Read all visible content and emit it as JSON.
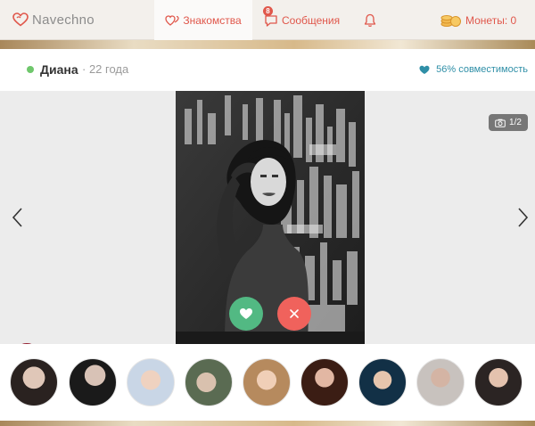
{
  "header": {
    "logo_text": "Navechno",
    "nav": {
      "dating_label": "Знакомства",
      "messages_label": "Сообщения",
      "messages_badge": "8",
      "coins_label": "Монеты: 0"
    }
  },
  "profile": {
    "name": "Диана",
    "age": "· 22 года",
    "compatibility": "56% совместимость",
    "photo_counter": "1/2",
    "online": true
  },
  "thumbnails": [
    {
      "name": "thumb-1",
      "icon": "avatar-photo"
    },
    {
      "name": "thumb-2",
      "icon": "avatar-photo"
    },
    {
      "name": "thumb-3",
      "icon": "avatar-photo"
    },
    {
      "name": "thumb-4",
      "icon": "avatar-photo"
    },
    {
      "name": "thumb-5",
      "icon": "avatar-photo"
    },
    {
      "name": "thumb-6",
      "icon": "avatar-photo"
    },
    {
      "name": "thumb-7",
      "icon": "avatar-photo"
    },
    {
      "name": "thumb-8",
      "icon": "avatar-photo"
    },
    {
      "name": "thumb-9",
      "icon": "avatar-photo"
    }
  ],
  "colors": {
    "brand": "#e0574b",
    "like": "#52b983",
    "skip": "#f0625c",
    "online": "#6fc76c",
    "compat": "#2f8fa7",
    "gift": "#931d2f"
  },
  "icons": {
    "logo": "heart-logo-icon",
    "dating": "hearts-icon",
    "messages": "chat-bubble-icon",
    "notifications": "bell-icon",
    "coins": "coins-icon",
    "compat": "heart-link-icon",
    "counter": "camera-icon",
    "prev": "chevron-left-icon",
    "next": "chevron-right-icon",
    "gift": "gift-icon",
    "report": "flag-icon",
    "like": "heart-icon",
    "skip": "close-icon"
  }
}
